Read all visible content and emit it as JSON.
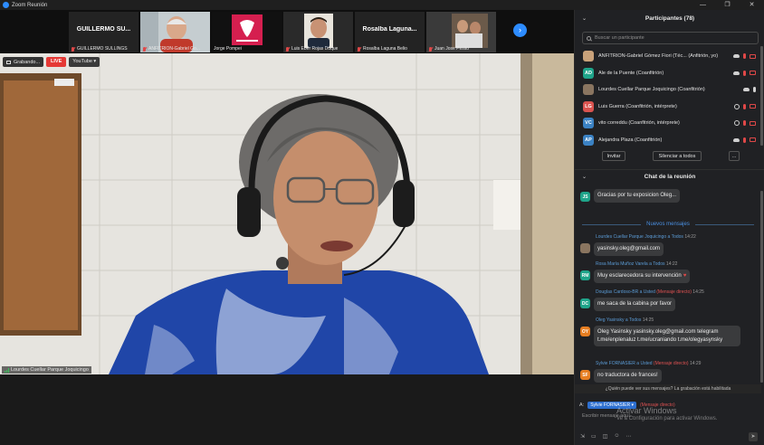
{
  "window": {
    "title": "Zoom Reunión",
    "controls": [
      "—",
      "❐",
      "✕"
    ]
  },
  "thumbnails": [
    {
      "big_name": "GUILLERMO SU...",
      "label": "GUILLERMO SULLINGS",
      "muted": true,
      "video": false
    },
    {
      "big_name": "",
      "label": "ANFITRION-Gabriel Go...",
      "muted": true,
      "video": true
    },
    {
      "big_name": "",
      "label": "Jorge Pompei",
      "muted": false,
      "video": true
    },
    {
      "big_name": "",
      "label": "Luis Eber Rojas Duque",
      "muted": true,
      "video": true
    },
    {
      "big_name": "Rosalba Laguna...",
      "label": "Rosalba Laguna Belio",
      "muted": true,
      "video": false
    },
    {
      "big_name": "",
      "label": "Juan Jose Pesito",
      "muted": true,
      "video": true
    }
  ],
  "recording": {
    "label": "Grabando...",
    "live": "LIVE",
    "youtube": "YouTube ▾"
  },
  "speaker": {
    "name": "Lourdes Cuellar Parque Joquicingo"
  },
  "participants": {
    "header": "Participantes (78)",
    "search_placeholder": "Buscar un participante",
    "list": [
      {
        "initials": "",
        "name": "ANFITRION-Gabriel Gómez Fiori (Téc...  (Anfitrión, yo)",
        "color": "#c9a27a",
        "mic_muted": true,
        "cam_off": true
      },
      {
        "initials": "AD",
        "name": "Ale de la Puente (Coanfitrión)",
        "color": "#1fa48a",
        "mic_muted": true,
        "cam_off": true
      },
      {
        "initials": "",
        "name": "Lourdes Cuellar Parque Joquicingo (Coanfitrión)",
        "color": "#8a7560",
        "mic_muted": false,
        "cam_off": false
      },
      {
        "initials": "LG",
        "name": "Luis Guerra (Coanfitrión, intérprete)",
        "color": "#d9534f",
        "mic_muted": true,
        "cam_off": true
      },
      {
        "initials": "VC",
        "name": "vito correddu (Coanfitrión, intérprete)",
        "color": "#3b82c4",
        "mic_muted": true,
        "cam_off": true
      },
      {
        "initials": "AP",
        "name": "Alejandra Plaza (Coanfitrión)",
        "color": "#3b82c4",
        "mic_muted": true,
        "cam_off": true
      }
    ],
    "invite_label": "Invitar",
    "mute_all_label": "Silenciar a todos",
    "more_label": "..."
  },
  "chat": {
    "header": "Chat de la reunión",
    "new_messages_label": "Nuevos mensajes",
    "messages": [
      {
        "initials": "JS",
        "color": "#1fa48a",
        "sender": "",
        "to": "",
        "private": "",
        "time": "",
        "text": "Gracias por tu exposicion Oleg..."
      },
      {
        "initials": "",
        "color": "#8a7560",
        "sender": "Lourdes Cuellar Parque Joquicingo",
        "to": "a Todos",
        "private": "",
        "time": "14:22",
        "text": "yasinsky.oleg@gmail.com"
      },
      {
        "initials": "RM",
        "color": "#1fa48a",
        "sender": "Rosa María Muñoz Varela",
        "to": "a Todos",
        "private": "",
        "time": "14:22",
        "text": "Muy esclarecedora su intervención"
      },
      {
        "initials": "DC",
        "color": "#1fa48a",
        "sender": "Douglas Cardoso-BR",
        "to": "a Usted",
        "private": "(Mensaje directo)",
        "time": "14:25",
        "text": "me saca de la cabina por favor"
      },
      {
        "initials": "OY",
        "color": "#e67e22",
        "sender": "Oleg Yasinsky",
        "to": "a Todos",
        "private": "",
        "time": "14:25",
        "text": "Oleg Yasinsky yasinsky.oleg@gmail.com telegram t.me/enplenaluz t.me/ucraniando t.me/olegyasynsky"
      },
      {
        "initials": "SF",
        "color": "#e67e22",
        "sender": "Sylvie FORNASIER",
        "to": "a Usted",
        "private": "(Mensaje directo)",
        "time": "14:29",
        "text": "no traductora de frances!"
      }
    ],
    "notice": "¿Quién puede ver sus mensajes? La grabación está habilitada",
    "to_label": "A:",
    "recipient": "Sylvie FORNASIER ▾",
    "direct_label": "(Mensaje directo)",
    "compose_placeholder": "Escribir mensaje aquí...",
    "watermark_title": "Activar Windows",
    "watermark_sub": "Ve a Configuración para activar Windows."
  }
}
